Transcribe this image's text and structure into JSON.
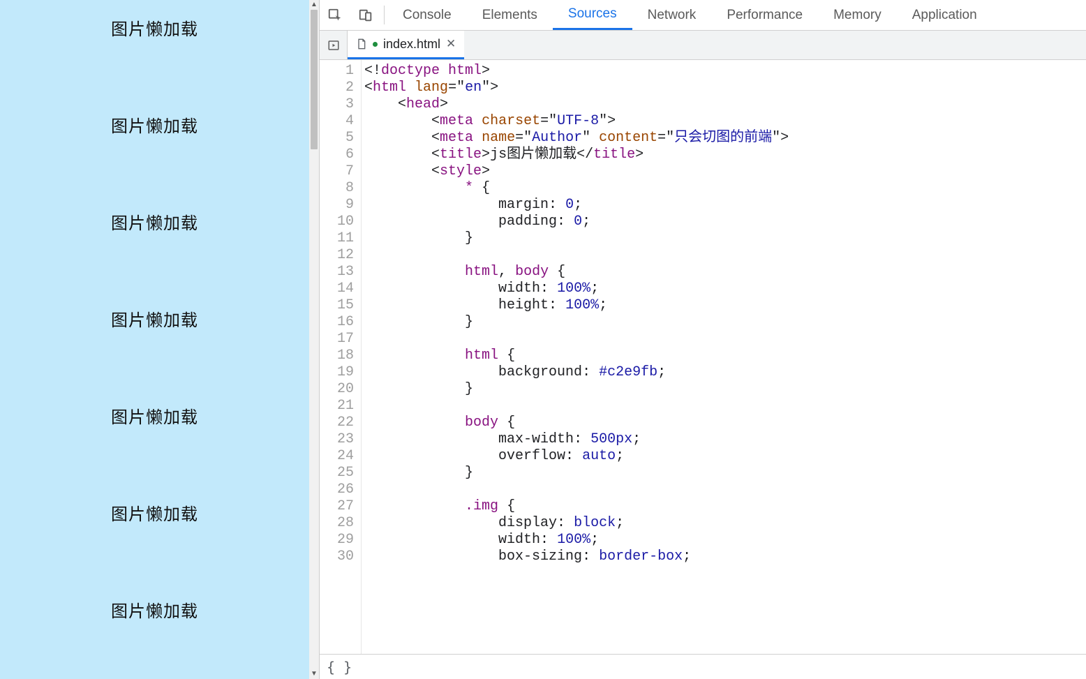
{
  "preview": {
    "background": "#c2e9fb",
    "item_label": "图片懒加载",
    "item_count": 7
  },
  "devtools": {
    "tabs": [
      "Console",
      "Elements",
      "Sources",
      "Network",
      "Performance",
      "Memory",
      "Application"
    ],
    "active_tab": "Sources",
    "file_tab": {
      "name": "index.html",
      "modified": true
    },
    "footer_symbol": "{ }",
    "code_lines": [
      {
        "n": 1,
        "tokens": [
          {
            "c": "punc",
            "t": "<!"
          },
          {
            "c": "tag",
            "t": "doctype html"
          },
          {
            "c": "punc",
            "t": ">"
          }
        ]
      },
      {
        "n": 2,
        "tokens": [
          {
            "c": "punc",
            "t": "<"
          },
          {
            "c": "tag",
            "t": "html"
          },
          {
            "c": "txt",
            "t": " "
          },
          {
            "c": "attr",
            "t": "lang"
          },
          {
            "c": "punc",
            "t": "=\""
          },
          {
            "c": "str",
            "t": "en"
          },
          {
            "c": "punc",
            "t": "\">"
          }
        ]
      },
      {
        "n": 3,
        "indent": 4,
        "tokens": [
          {
            "c": "punc",
            "t": "<"
          },
          {
            "c": "tag",
            "t": "head"
          },
          {
            "c": "punc",
            "t": ">"
          }
        ]
      },
      {
        "n": 4,
        "indent": 8,
        "tokens": [
          {
            "c": "punc",
            "t": "<"
          },
          {
            "c": "tag",
            "t": "meta"
          },
          {
            "c": "txt",
            "t": " "
          },
          {
            "c": "attr",
            "t": "charset"
          },
          {
            "c": "punc",
            "t": "=\""
          },
          {
            "c": "str",
            "t": "UTF-8"
          },
          {
            "c": "punc",
            "t": "\">"
          }
        ]
      },
      {
        "n": 5,
        "indent": 8,
        "tokens": [
          {
            "c": "punc",
            "t": "<"
          },
          {
            "c": "tag",
            "t": "meta"
          },
          {
            "c": "txt",
            "t": " "
          },
          {
            "c": "attr",
            "t": "name"
          },
          {
            "c": "punc",
            "t": "=\""
          },
          {
            "c": "str",
            "t": "Author"
          },
          {
            "c": "punc",
            "t": "\" "
          },
          {
            "c": "attr",
            "t": "content"
          },
          {
            "c": "punc",
            "t": "=\""
          },
          {
            "c": "str",
            "t": "只会切图的前端"
          },
          {
            "c": "punc",
            "t": "\">"
          }
        ]
      },
      {
        "n": 6,
        "indent": 8,
        "tokens": [
          {
            "c": "punc",
            "t": "<"
          },
          {
            "c": "tag",
            "t": "title"
          },
          {
            "c": "punc",
            "t": ">"
          },
          {
            "c": "txt",
            "t": "js图片懒加载"
          },
          {
            "c": "punc",
            "t": "</"
          },
          {
            "c": "tag",
            "t": "title"
          },
          {
            "c": "punc",
            "t": ">"
          }
        ]
      },
      {
        "n": 7,
        "indent": 8,
        "tokens": [
          {
            "c": "punc",
            "t": "<"
          },
          {
            "c": "tag",
            "t": "style"
          },
          {
            "c": "punc",
            "t": ">"
          }
        ]
      },
      {
        "n": 8,
        "indent": 12,
        "tokens": [
          {
            "c": "sel",
            "t": "*"
          },
          {
            "c": "txt",
            "t": " "
          },
          {
            "c": "punc",
            "t": "{"
          }
        ]
      },
      {
        "n": 9,
        "indent": 16,
        "tokens": [
          {
            "c": "prop",
            "t": "margin"
          },
          {
            "c": "punc",
            "t": ": "
          },
          {
            "c": "val",
            "t": "0"
          },
          {
            "c": "punc",
            "t": ";"
          }
        ]
      },
      {
        "n": 10,
        "indent": 16,
        "tokens": [
          {
            "c": "prop",
            "t": "padding"
          },
          {
            "c": "punc",
            "t": ": "
          },
          {
            "c": "val",
            "t": "0"
          },
          {
            "c": "punc",
            "t": ";"
          }
        ]
      },
      {
        "n": 11,
        "indent": 12,
        "tokens": [
          {
            "c": "punc",
            "t": "}"
          }
        ]
      },
      {
        "n": 12,
        "tokens": []
      },
      {
        "n": 13,
        "indent": 12,
        "tokens": [
          {
            "c": "sel",
            "t": "html"
          },
          {
            "c": "punc",
            "t": ", "
          },
          {
            "c": "sel",
            "t": "body"
          },
          {
            "c": "txt",
            "t": " "
          },
          {
            "c": "punc",
            "t": "{"
          }
        ]
      },
      {
        "n": 14,
        "indent": 16,
        "tokens": [
          {
            "c": "prop",
            "t": "width"
          },
          {
            "c": "punc",
            "t": ": "
          },
          {
            "c": "val",
            "t": "100%"
          },
          {
            "c": "punc",
            "t": ";"
          }
        ]
      },
      {
        "n": 15,
        "indent": 16,
        "tokens": [
          {
            "c": "prop",
            "t": "height"
          },
          {
            "c": "punc",
            "t": ": "
          },
          {
            "c": "val",
            "t": "100%"
          },
          {
            "c": "punc",
            "t": ";"
          }
        ]
      },
      {
        "n": 16,
        "indent": 12,
        "tokens": [
          {
            "c": "punc",
            "t": "}"
          }
        ]
      },
      {
        "n": 17,
        "tokens": []
      },
      {
        "n": 18,
        "indent": 12,
        "tokens": [
          {
            "c": "sel",
            "t": "html"
          },
          {
            "c": "txt",
            "t": " "
          },
          {
            "c": "punc",
            "t": "{"
          }
        ]
      },
      {
        "n": 19,
        "indent": 16,
        "tokens": [
          {
            "c": "prop",
            "t": "background"
          },
          {
            "c": "punc",
            "t": ": "
          },
          {
            "c": "val",
            "t": "#c2e9fb"
          },
          {
            "c": "punc",
            "t": ";"
          }
        ]
      },
      {
        "n": 20,
        "indent": 12,
        "tokens": [
          {
            "c": "punc",
            "t": "}"
          }
        ]
      },
      {
        "n": 21,
        "tokens": []
      },
      {
        "n": 22,
        "indent": 12,
        "tokens": [
          {
            "c": "sel",
            "t": "body"
          },
          {
            "c": "txt",
            "t": " "
          },
          {
            "c": "punc",
            "t": "{"
          }
        ]
      },
      {
        "n": 23,
        "indent": 16,
        "tokens": [
          {
            "c": "prop",
            "t": "max-width"
          },
          {
            "c": "punc",
            "t": ": "
          },
          {
            "c": "val",
            "t": "500px"
          },
          {
            "c": "punc",
            "t": ";"
          }
        ]
      },
      {
        "n": 24,
        "indent": 16,
        "tokens": [
          {
            "c": "prop",
            "t": "overflow"
          },
          {
            "c": "punc",
            "t": ": "
          },
          {
            "c": "val",
            "t": "auto"
          },
          {
            "c": "punc",
            "t": ";"
          }
        ]
      },
      {
        "n": 25,
        "indent": 12,
        "tokens": [
          {
            "c": "punc",
            "t": "}"
          }
        ]
      },
      {
        "n": 26,
        "tokens": []
      },
      {
        "n": 27,
        "indent": 12,
        "tokens": [
          {
            "c": "sel",
            "t": ".img"
          },
          {
            "c": "txt",
            "t": " "
          },
          {
            "c": "punc",
            "t": "{"
          }
        ]
      },
      {
        "n": 28,
        "indent": 16,
        "tokens": [
          {
            "c": "prop",
            "t": "display"
          },
          {
            "c": "punc",
            "t": ": "
          },
          {
            "c": "val",
            "t": "block"
          },
          {
            "c": "punc",
            "t": ";"
          }
        ]
      },
      {
        "n": 29,
        "indent": 16,
        "tokens": [
          {
            "c": "prop",
            "t": "width"
          },
          {
            "c": "punc",
            "t": ": "
          },
          {
            "c": "val",
            "t": "100%"
          },
          {
            "c": "punc",
            "t": ";"
          }
        ]
      },
      {
        "n": 30,
        "indent": 16,
        "tokens": [
          {
            "c": "prop",
            "t": "box-sizing"
          },
          {
            "c": "punc",
            "t": ": "
          },
          {
            "c": "val",
            "t": "border-box"
          },
          {
            "c": "punc",
            "t": ";"
          }
        ]
      }
    ]
  }
}
